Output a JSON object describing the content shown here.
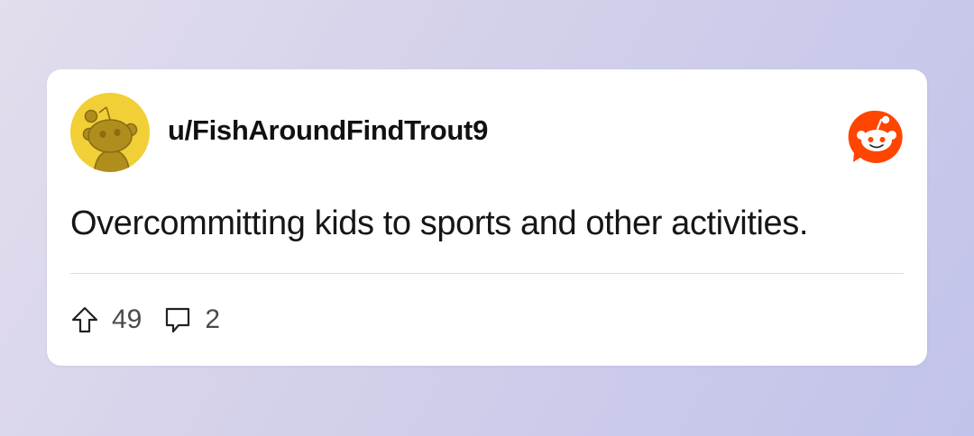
{
  "post": {
    "username": "u/FishAroundFindTrout9",
    "body": "Overcommitting kids to sports and other activities.",
    "upvotes": "49",
    "comments": "2"
  },
  "icons": {
    "avatar": "snoo-avatar-icon",
    "logo": "reddit-logo-icon",
    "upvote": "upvote-arrow-icon",
    "comment": "comment-bubble-icon"
  },
  "colors": {
    "avatar_bg": "#f1cf37",
    "reddit_orange": "#ff4500"
  }
}
